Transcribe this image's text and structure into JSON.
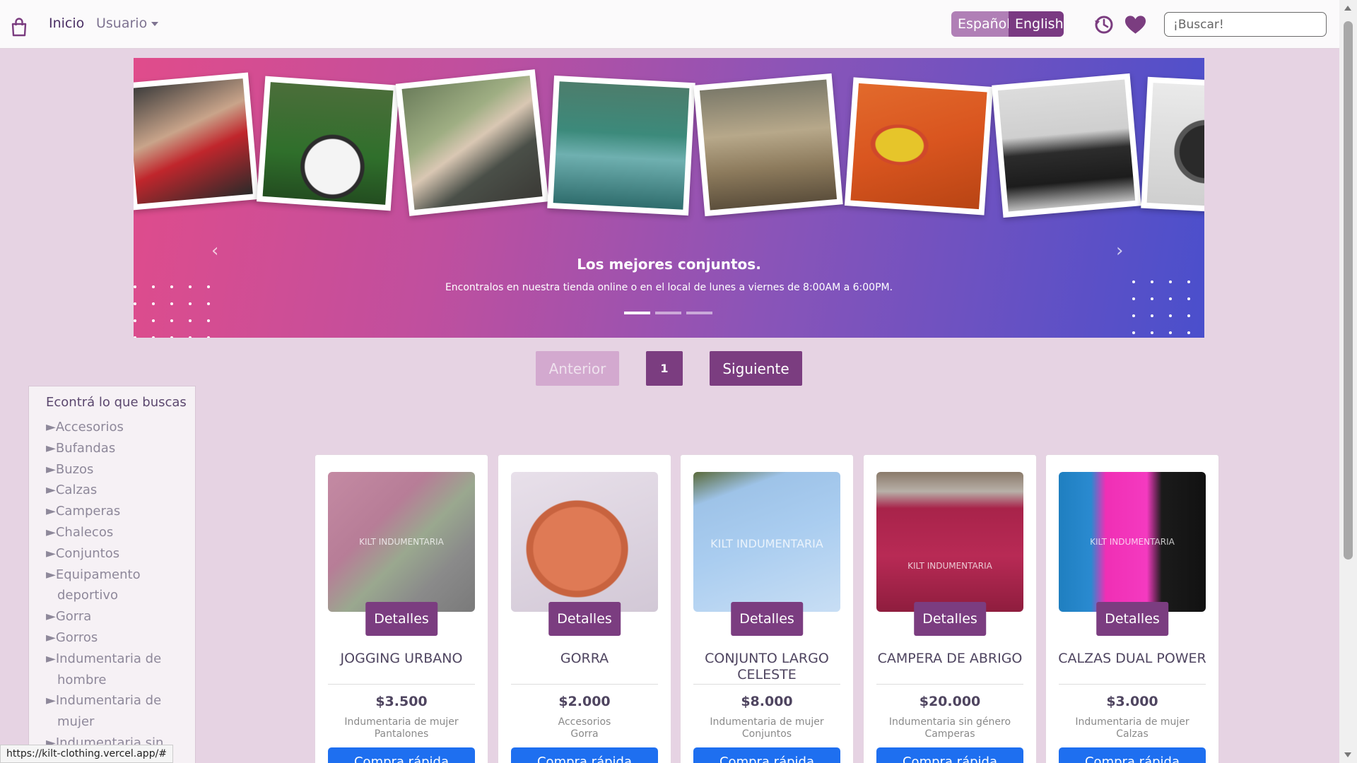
{
  "nav": {
    "home_label": "Inicio",
    "user_label": "Usuario",
    "lang_es": "Español",
    "lang_en": "English",
    "search_placeholder": "¡Buscar!",
    "brand_icon": "shopping-bag-icon",
    "history_icon": "history-icon",
    "favorites_icon": "heart-icon"
  },
  "carousel": {
    "title": "Los mejores conjuntos.",
    "subtitle": "Encontralos en nuestra tienda online o en el local de lunes a viernes de 8:00AM a 6:00PM.",
    "slide_count": 3,
    "active_slide": 1,
    "photos": [
      "boxing",
      "soccer",
      "running",
      "swimming",
      "cycling",
      "tennis",
      "basketball",
      "weights"
    ]
  },
  "pagination": {
    "prev_label": "Anterior",
    "current_page": "1",
    "next_label": "Siguiente"
  },
  "sidebar": {
    "title": "Econtrá lo que buscas",
    "categories": [
      "►Accesorios",
      "►Bufandas",
      "►Buzos",
      "►Calzas",
      "►Camperas",
      "►Chalecos",
      "►Conjuntos",
      "►Equipamento deportivo",
      "►Gorra",
      "►Gorros",
      "►Indumentaria de hombre",
      "►Indumentaria de mujer",
      "►Indumentaria sin"
    ]
  },
  "products": [
    {
      "name": "JOGGING URBANO",
      "price": "$3.500",
      "category": "Indumentaria de mujer",
      "subcategory": "Pantalones",
      "details_label": "Detalles",
      "buy_label": "Compra rápida",
      "watermark": "KILT INDUMENTARIA"
    },
    {
      "name": "GORRA",
      "price": "$2.000",
      "category": "Accesorios",
      "subcategory": "Gorra",
      "details_label": "Detalles",
      "buy_label": "Compra rápida",
      "watermark": ""
    },
    {
      "name": "CONJUNTO LARGO CELESTE",
      "price": "$8.000",
      "category": "Indumentaria de mujer",
      "subcategory": "Conjuntos",
      "details_label": "Detalles",
      "buy_label": "Compra rápida",
      "watermark": "KILT INDUMENTARIA"
    },
    {
      "name": "CAMPERA DE ABRIGO",
      "price": "$20.000",
      "category": "Indumentaria sin género",
      "subcategory": "Camperas",
      "details_label": "Detalles",
      "buy_label": "Compra rápida",
      "watermark": "KILT INDUMENTARIA"
    },
    {
      "name": "CALZAS DUAL POWER",
      "price": "$3.000",
      "category": "Indumentaria de mujer",
      "subcategory": "Calzas",
      "details_label": "Detalles",
      "buy_label": "Compra rápida",
      "watermark": "KILT INDUMENTARIA"
    }
  ],
  "status_url": "https://kilt-clothing.vercel.app/#",
  "colors": {
    "primary": "#7b3d80",
    "accent_light": "#b07fb6",
    "background": "#e6d3e3",
    "buy_button": "#1e6ff0"
  }
}
